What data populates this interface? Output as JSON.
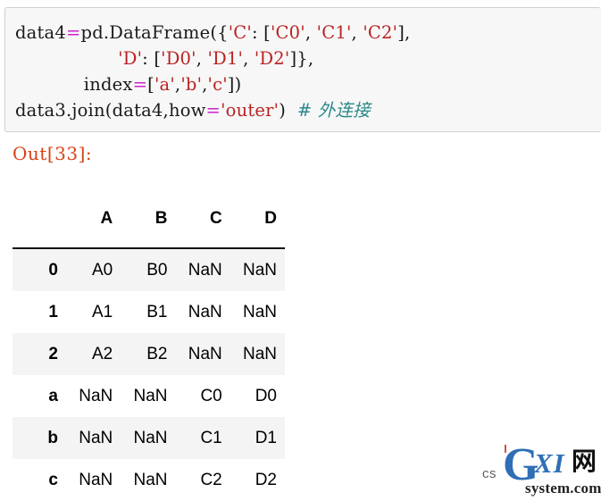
{
  "notebook": {
    "code_cell": {
      "background": "#f7f7f7",
      "border_color": "#cfcfcf",
      "lines": [
        [
          {
            "t": "data4",
            "c": "plain"
          },
          {
            "t": "=",
            "c": "op"
          },
          {
            "t": "pd.DataFrame({",
            "c": "plain"
          },
          {
            "t": "'C'",
            "c": "str"
          },
          {
            "t": ": [",
            "c": "plain"
          },
          {
            "t": "'C0'",
            "c": "str"
          },
          {
            "t": ", ",
            "c": "plain"
          },
          {
            "t": "'C1'",
            "c": "str"
          },
          {
            "t": ", ",
            "c": "plain"
          },
          {
            "t": "'C2'",
            "c": "str"
          },
          {
            "t": "],",
            "c": "plain"
          }
        ],
        [
          {
            "t": "                  ",
            "c": "plain"
          },
          {
            "t": "'D'",
            "c": "str"
          },
          {
            "t": ": [",
            "c": "plain"
          },
          {
            "t": "'D0'",
            "c": "str"
          },
          {
            "t": ", ",
            "c": "plain"
          },
          {
            "t": "'D1'",
            "c": "str"
          },
          {
            "t": ", ",
            "c": "plain"
          },
          {
            "t": "'D2'",
            "c": "str"
          },
          {
            "t": "]},",
            "c": "plain"
          }
        ],
        [
          {
            "t": "            index",
            "c": "plain"
          },
          {
            "t": "=",
            "c": "op"
          },
          {
            "t": "[",
            "c": "plain"
          },
          {
            "t": "'a'",
            "c": "str"
          },
          {
            "t": ",",
            "c": "plain"
          },
          {
            "t": "'b'",
            "c": "str"
          },
          {
            "t": ",",
            "c": "plain"
          },
          {
            "t": "'c'",
            "c": "str"
          },
          {
            "t": "])",
            "c": "plain"
          }
        ],
        [
          {
            "t": "data3.join(data4,how",
            "c": "plain"
          },
          {
            "t": "=",
            "c": "op"
          },
          {
            "t": "'outer'",
            "c": "str"
          },
          {
            "t": ")  ",
            "c": "plain"
          },
          {
            "t": "# 外连接",
            "c": "cmt"
          }
        ]
      ],
      "colors": {
        "string": "#bb2222",
        "operator": "#cc22cc",
        "comment": "#2d8a8a",
        "plain": "#1a1a1a"
      }
    },
    "out_prompt": {
      "label": "Out[33]:",
      "color": "#d84315"
    },
    "dataframe": {
      "index_header": "",
      "columns": [
        "A",
        "B",
        "C",
        "D"
      ],
      "rows": [
        {
          "index": "0",
          "cells": [
            "A0",
            "B0",
            "NaN",
            "NaN"
          ],
          "shaded": true
        },
        {
          "index": "1",
          "cells": [
            "A1",
            "B1",
            "NaN",
            "NaN"
          ],
          "shaded": false
        },
        {
          "index": "2",
          "cells": [
            "A2",
            "B2",
            "NaN",
            "NaN"
          ],
          "shaded": true
        },
        {
          "index": "a",
          "cells": [
            "NaN",
            "NaN",
            "C0",
            "D0"
          ],
          "shaded": false
        },
        {
          "index": "b",
          "cells": [
            "NaN",
            "NaN",
            "C1",
            "D1"
          ],
          "shaded": true
        },
        {
          "index": "c",
          "cells": [
            "NaN",
            "NaN",
            "C2",
            "D2"
          ],
          "shaded": false
        }
      ],
      "shaded_row_color": "#f4f4f4",
      "plain_row_color": "#ffffff",
      "header_rule_color": "#111111"
    }
  },
  "watermark": {
    "prefix": "cs",
    "logo_letter": "G",
    "logo_xi": "XI",
    "logo_cjk": "网",
    "domain": "system.com",
    "accent_color": "#2f6fb5"
  }
}
